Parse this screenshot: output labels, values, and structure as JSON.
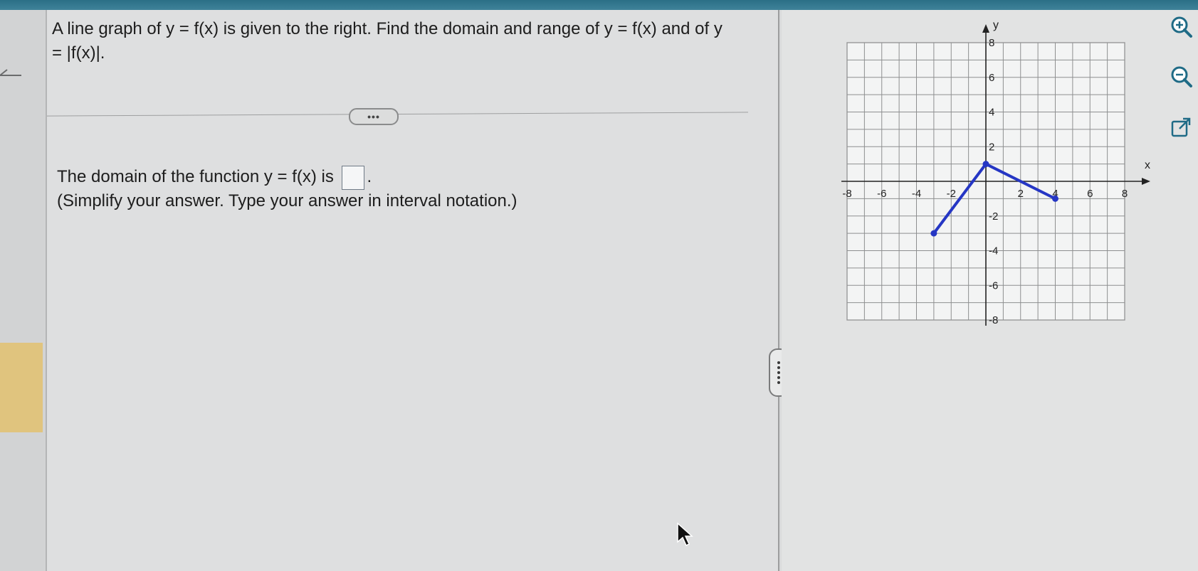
{
  "question": {
    "text": "A line graph of y = f(x) is given to the right. Find the domain and range of y = f(x) and of y = |f(x)|."
  },
  "expand_button": {
    "label": "•••"
  },
  "answer": {
    "prefix": "The domain of the function y = f(x) is",
    "suffix": ".",
    "hint": "(Simplify your answer. Type your answer in interval notation.)",
    "value": ""
  },
  "graph": {
    "x_axis_label": "x",
    "y_axis_label": "y",
    "x_tick_labels": [
      "-8",
      "-6",
      "-4",
      "-2",
      "2",
      "4",
      "6",
      "8"
    ],
    "y_tick_labels": [
      "8",
      "6",
      "4",
      "2",
      "-2",
      "-4",
      "-6",
      "-8"
    ],
    "line_color": "#2536c4"
  },
  "chart_data": {
    "type": "line",
    "xlim": [
      -8,
      8
    ],
    "ylim": [
      -8,
      8
    ],
    "grid": true,
    "series": [
      {
        "x": [
          -3,
          0,
          4
        ],
        "y": [
          -3,
          1,
          -1
        ]
      }
    ],
    "endpoints": "closed"
  },
  "tools": {
    "zoom_in_icon": "zoom-in-icon",
    "zoom_out_icon": "zoom-out-icon",
    "popout_icon": "external-link-icon"
  }
}
